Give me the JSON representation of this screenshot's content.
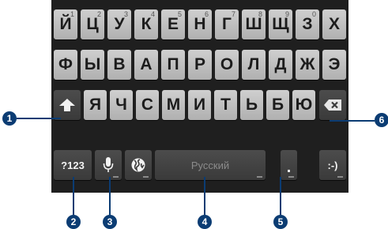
{
  "keyboard": {
    "row1": [
      {
        "char": "Й",
        "num": "1"
      },
      {
        "char": "Ц",
        "num": "2"
      },
      {
        "char": "У",
        "num": "3"
      },
      {
        "char": "К",
        "num": "4"
      },
      {
        "char": "Е",
        "num": "5"
      },
      {
        "char": "Н",
        "num": "6"
      },
      {
        "char": "Г",
        "num": "7"
      },
      {
        "char": "Ш",
        "num": "8"
      },
      {
        "char": "Щ",
        "num": "9"
      },
      {
        "char": "З",
        "num": "0"
      },
      {
        "char": "Х",
        "num": ""
      }
    ],
    "row2": [
      "Ф",
      "Ы",
      "В",
      "А",
      "П",
      "Р",
      "О",
      "Л",
      "Д",
      "Ж",
      "Э"
    ],
    "row3": [
      "Я",
      "Ч",
      "С",
      "М",
      "И",
      "Т",
      "Ь",
      "Б",
      "Ю"
    ],
    "symbols_label": "?123",
    "space_label": "Русский",
    "period_label": ".",
    "smiley_label": ":-)"
  },
  "callouts": [
    "1",
    "2",
    "3",
    "4",
    "5",
    "6"
  ],
  "colors": {
    "keyboard_bg": "#1f1f1f",
    "letter_key": "#c4c4c4",
    "function_key": "#434343",
    "callout": "#0b3c73"
  },
  "icons": {
    "shift": "shift-arrow-icon",
    "backspace": "backspace-icon",
    "voice": "microphone-icon",
    "language": "globe-icon"
  }
}
